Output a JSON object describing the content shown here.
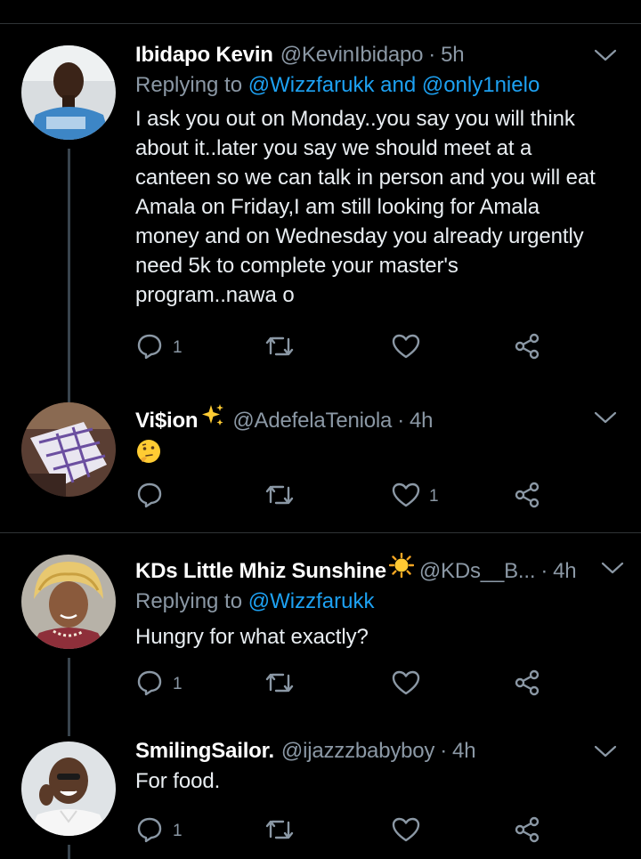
{
  "tweets": [
    {
      "name": "Ibidapo Kevin",
      "handle": "@KevinIbidapo",
      "sep": "·",
      "time": "5h",
      "replying_label": "Replying to",
      "mention1": "@Wizzfarukk",
      "and_label": "and",
      "mention2": "@only1nielo",
      "body_lines": [
        "I ask you out on Monday..you say you will think",
        "about it..later you say we should meet at a",
        "canteen so we can talk in person and you will eat",
        "Amala on Friday,I am still looking for Amala",
        "money and on Wednesday you already urgently",
        "need 5k to complete your master's",
        "program..nawa o"
      ],
      "reply_count": "1",
      "like_count": ""
    },
    {
      "name": "Vi$ion",
      "name_emoji": "sparkles-emoji",
      "handle": "@AdefelaTeniola",
      "sep": "·",
      "time": "4h",
      "body_emoji": "thinking-face-emoji",
      "reply_count": "",
      "like_count": "1"
    },
    {
      "name": "KDs Little Mhiz Sunshine",
      "name_emoji": "sun-emoji",
      "handle": "@KDs__B...",
      "sep": "·",
      "time": "4h",
      "replying_label": "Replying to",
      "mention1": "@Wizzfarukk",
      "body": "Hungry for what exactly?",
      "reply_count": "1",
      "like_count": ""
    },
    {
      "name": "SmilingSailor.",
      "handle": "@ijazzzbabyboy",
      "sep": "·",
      "time": "4h",
      "body": "For food.",
      "reply_count": "1",
      "like_count": ""
    }
  ],
  "colors": {
    "background": "#000000",
    "secondary_text": "#8b98a5",
    "link": "#1da1f2",
    "divider": "#2f3336",
    "thread_line": "#38444d"
  }
}
